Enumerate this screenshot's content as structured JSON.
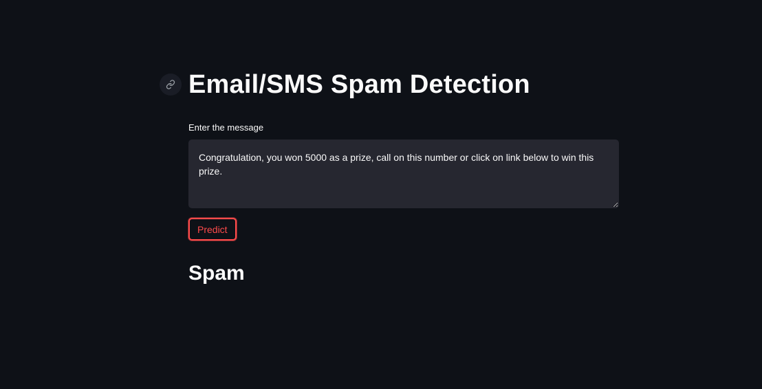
{
  "page": {
    "title": "Email/SMS Spam Detection",
    "anchor_icon": "link-icon"
  },
  "form": {
    "label": "Enter the message",
    "message_value": "Congratulation, you won 5000 as a prize, call on this number or click on link below to win this prize.",
    "predict_label": "Predict"
  },
  "result": {
    "text": "Spam"
  },
  "colors": {
    "background": "#0e1117",
    "textarea_bg": "#262730",
    "accent": "#ff4b4b",
    "text": "#fafafa"
  }
}
